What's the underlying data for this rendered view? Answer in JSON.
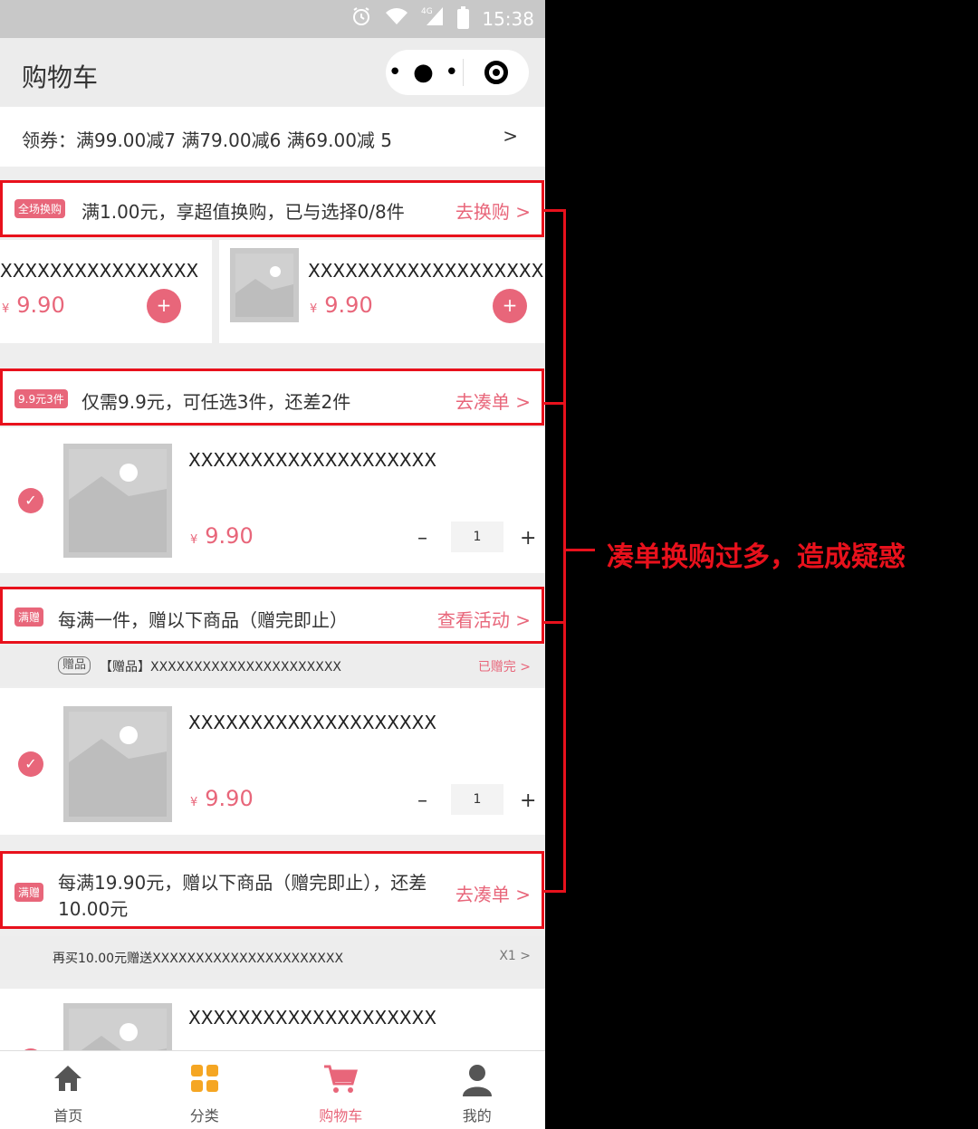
{
  "status_bar": {
    "time": "15:38",
    "network": "4G"
  },
  "nav": {
    "title": "购物车",
    "more": "• ● •"
  },
  "coupon": {
    "text": "领券：满99.00减7   满79.00减6   满69.00减 5",
    "chevron": ">"
  },
  "promo_exchange": {
    "tag": "全场换购",
    "text": "满1.00元，享超值换购，已与选择0/8件",
    "link": "去换购 >"
  },
  "exchange_items": [
    {
      "name": "XXXXXXXXXXXXXXXX",
      "yen": "¥",
      "price": "9.90",
      "add": "+"
    },
    {
      "name": "XXXXXXXXXXXXXXXXXXX",
      "yen": "¥",
      "price": "9.90",
      "add": "+"
    }
  ],
  "promo_bundle": {
    "tag": "9.9元3件",
    "text": "仅需9.9元，可任选3件，还差2件",
    "link": "去凑单 >"
  },
  "cart_item_1": {
    "name": "XXXXXXXXXXXXXXXXXXXX",
    "yen": "¥",
    "price": "9.90",
    "minus": "–",
    "qty": "1",
    "plus": "+",
    "check": "✓"
  },
  "promo_gift": {
    "tag": "满赠",
    "text": "每满一件，赠以下商品（赠完即止）",
    "link": "查看活动 >"
  },
  "gift_row": {
    "badge": "赠品",
    "text": "【赠品】XXXXXXXXXXXXXXXXXXXXXX",
    "link": "已赠完 >"
  },
  "cart_item_2": {
    "name": "XXXXXXXXXXXXXXXXXXXX",
    "yen": "¥",
    "price": "9.90",
    "minus": "–",
    "qty": "1",
    "plus": "+",
    "check": "✓"
  },
  "promo_gift2": {
    "tag": "满赠",
    "text_line1": "每满19.90元，赠以下商品（赠完即止），还差",
    "text_line2": "10.00元",
    "link": "去凑单 >"
  },
  "buy_more_row": {
    "text": "再买10.00元赠送XXXXXXXXXXXXXXXXXXXXXX",
    "link": "X1 >"
  },
  "cart_item_3": {
    "name": "XXXXXXXXXXXXXXXXXXXX"
  },
  "tabbar": [
    {
      "label": "首页"
    },
    {
      "label": "分类"
    },
    {
      "label": "购物车"
    },
    {
      "label": "我的"
    }
  ],
  "annotation": "凑单换购过多，造成疑惑",
  "colors": {
    "accent": "#e8667a",
    "annotation_red": "#e8111c",
    "category_orange": "#f5a623"
  }
}
